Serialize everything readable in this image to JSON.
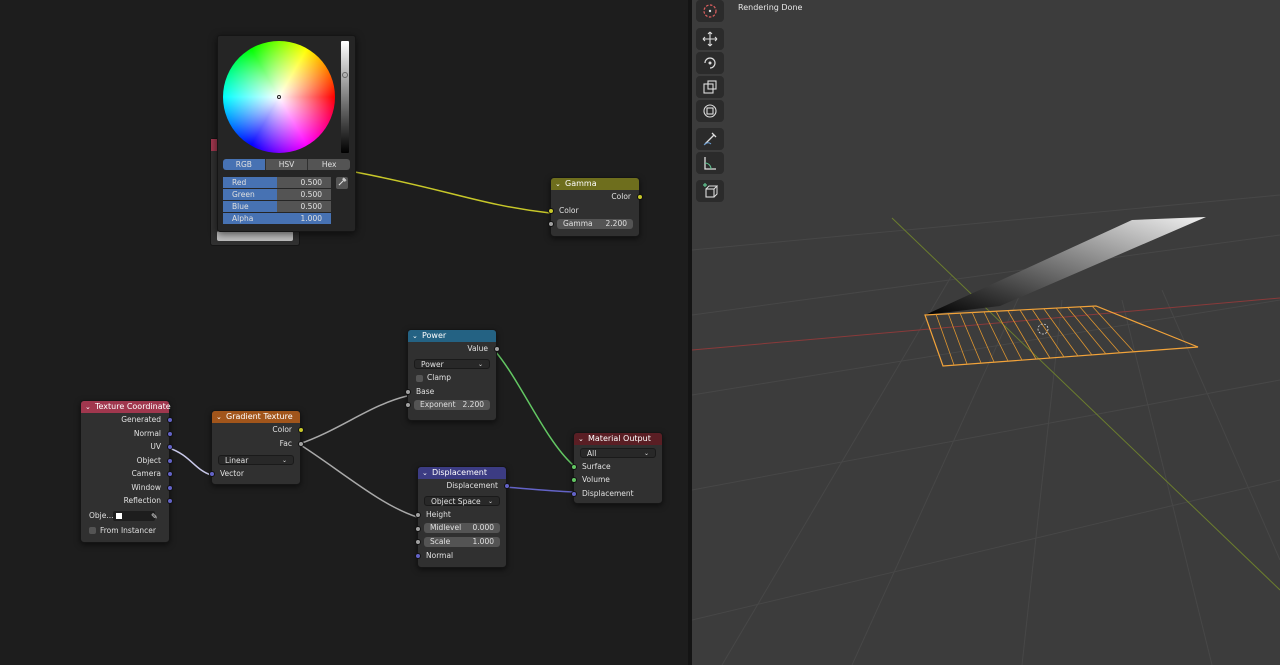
{
  "status_text": "Rendering Done",
  "color_picker": {
    "tabs": [
      "RGB",
      "HSV",
      "Hex"
    ],
    "active_tab": "RGB",
    "channels": [
      {
        "label": "Red",
        "value": "0.500"
      },
      {
        "label": "Green",
        "value": "0.500"
      },
      {
        "label": "Blue",
        "value": "0.500"
      },
      {
        "label": "Alpha",
        "value": "1.000"
      }
    ],
    "eyedropper_icon": "eyedropper-icon"
  },
  "nodes": {
    "gamma": {
      "title": "Gamma",
      "color_out": "Color",
      "color_in": "Color",
      "gamma_label": "Gamma",
      "gamma_value": "2.200",
      "header_color": "#6e6e1d"
    },
    "texture_coordinate": {
      "title": "Texture Coordinate",
      "outputs": [
        "Generated",
        "Normal",
        "UV",
        "Object",
        "Camera",
        "Window",
        "Reflection"
      ],
      "object_label": "Obje...",
      "from_instancer": "From Instancer",
      "header_color": "#a0374e"
    },
    "gradient_texture": {
      "title": "Gradient Texture",
      "color_out": "Color",
      "fac_out": "Fac",
      "type": "Linear",
      "vector_in": "Vector",
      "header_color": "#a1551b"
    },
    "power": {
      "title": "Power",
      "value_out": "Value",
      "operation": "Power",
      "clamp": "Clamp",
      "base_in": "Base",
      "exponent_label": "Exponent",
      "exponent_value": "2.200",
      "header_color": "#246283"
    },
    "displacement": {
      "title": "Displacement",
      "displacement_out": "Displacement",
      "space": "Object Space",
      "height_in": "Height",
      "midlevel_label": "Midlevel",
      "midlevel_value": "0.000",
      "scale_label": "Scale",
      "scale_value": "1.000",
      "normal_in": "Normal",
      "header_color": "#3c3c83"
    },
    "material_output": {
      "title": "Material Output",
      "target": "All",
      "surface_in": "Surface",
      "volume_in": "Volume",
      "displacement_in": "Displacement",
      "header_color": "#5a1e24"
    }
  },
  "viewport_tools": [
    "cursor-icon",
    "move-icon",
    "rotate-icon",
    "scale-icon",
    "transform-icon",
    "annotate-icon",
    "measure-icon",
    "add-cube-icon"
  ],
  "colors": {
    "accent": "#4772b3",
    "node_bg": "#303030",
    "editor_bg": "#1d1d1d",
    "viewport_bg": "#3c3c3c",
    "selection_orange": "#f2a33a"
  }
}
